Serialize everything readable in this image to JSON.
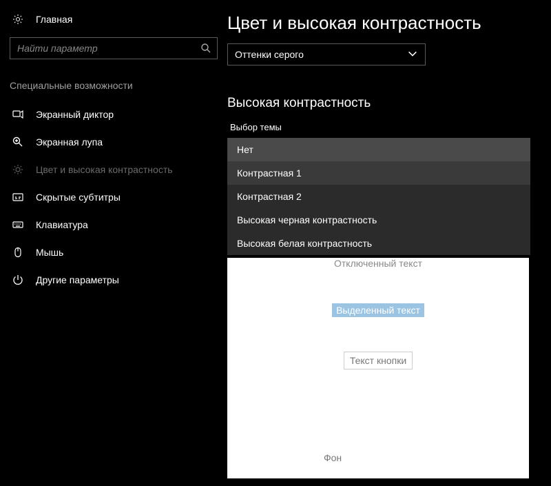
{
  "home": {
    "label": "Главная"
  },
  "search": {
    "placeholder": "Найти параметр"
  },
  "groupHeader": "Специальные возможности",
  "nav": [
    {
      "label": "Экранный диктор"
    },
    {
      "label": "Экранная лупа"
    },
    {
      "label": "Цвет и высокая контрастность"
    },
    {
      "label": "Скрытые субтитры"
    },
    {
      "label": "Клавиатура"
    },
    {
      "label": "Мышь"
    },
    {
      "label": "Другие параметры"
    }
  ],
  "title": "Цвет и высокая контрастность",
  "grayscaleSelect": {
    "value": "Оттенки серого"
  },
  "sectionTitle": "Высокая контрастность",
  "themeLabel": "Выбор темы",
  "themeOptions": [
    "Нет",
    "Контрастная 1",
    "Контрастная 2",
    "Высокая черная контрастность",
    "Высокая белая контрастность"
  ],
  "preview": {
    "disabled": "Отключенный текст",
    "highlighted": "Выделенный текст",
    "button": "Текст кнопки",
    "background": "Фон"
  }
}
